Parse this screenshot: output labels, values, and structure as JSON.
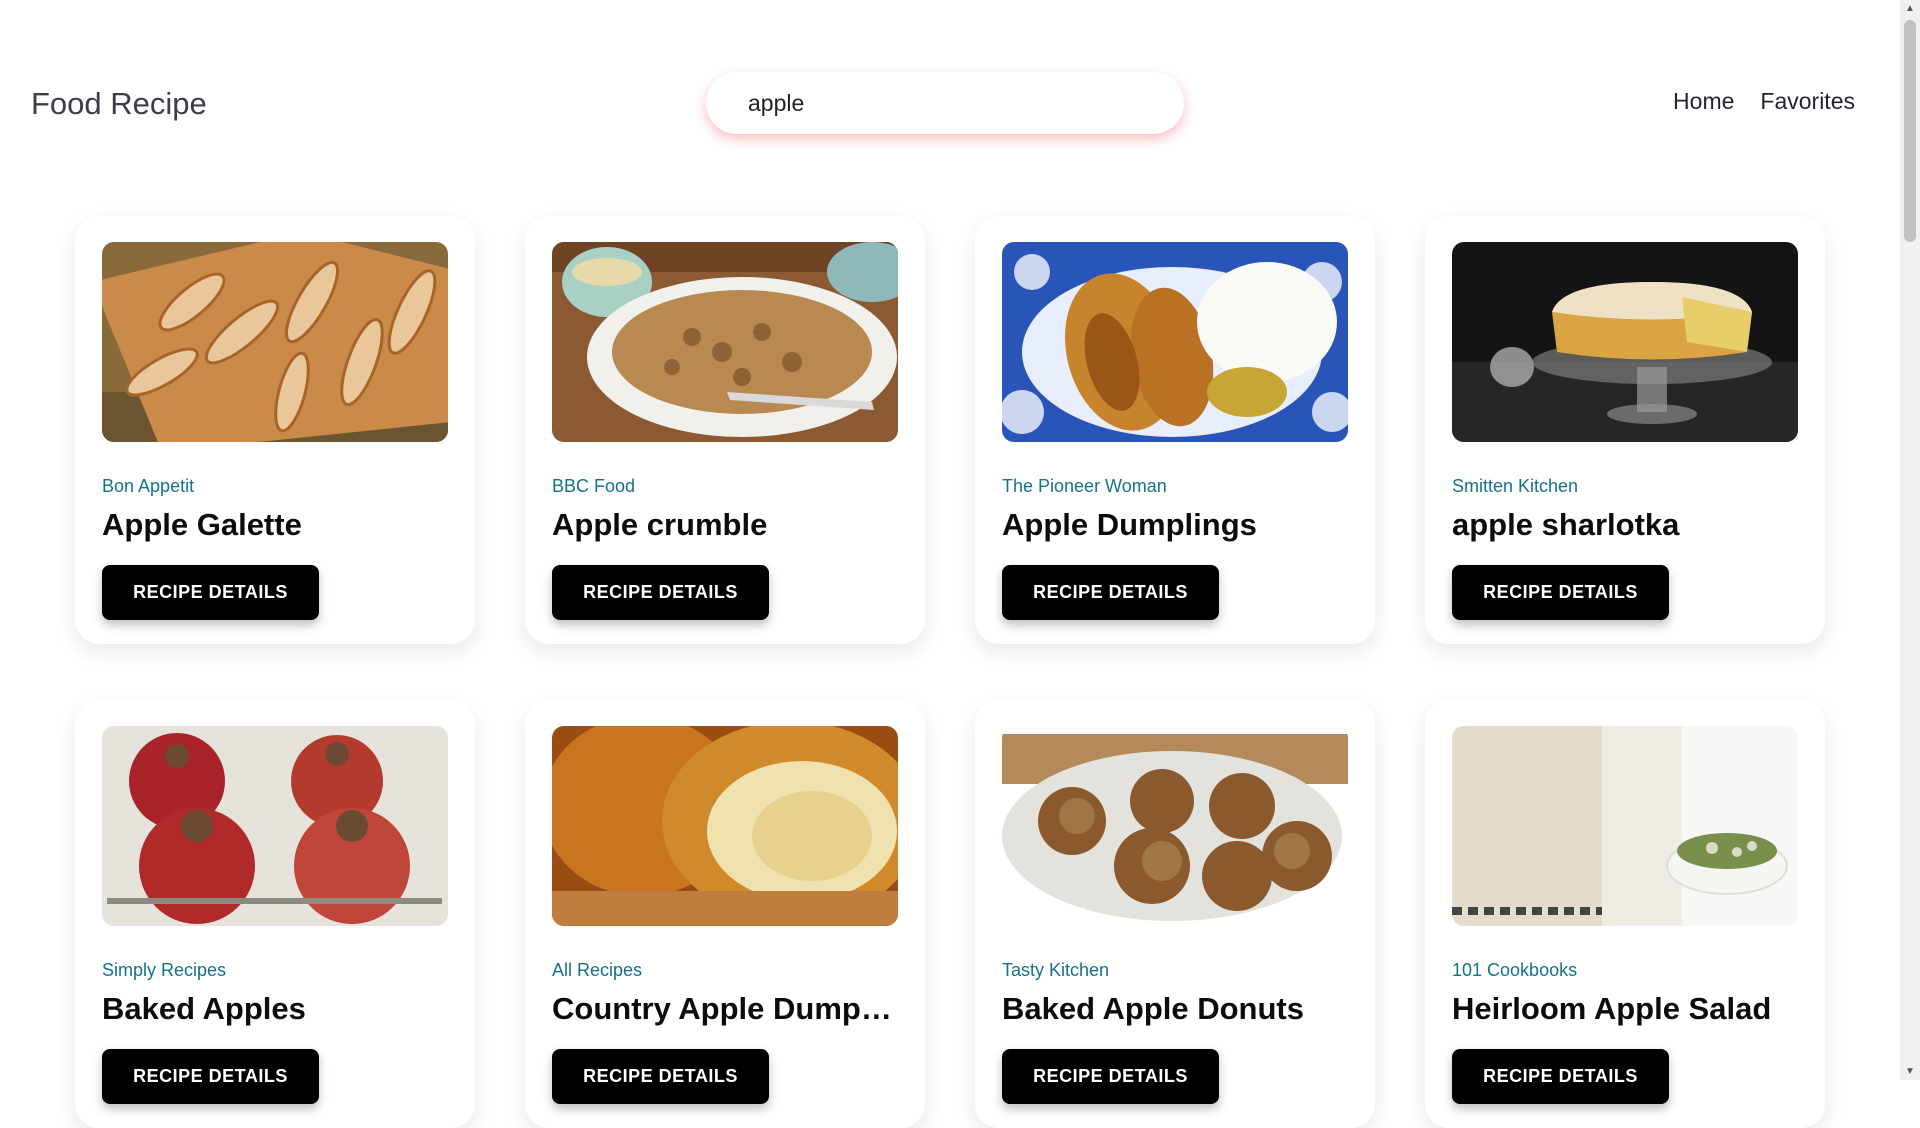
{
  "header": {
    "brand": "Food Recipe",
    "search_value": "apple",
    "nav": [
      "Home",
      "Favorites"
    ]
  },
  "recipes": [
    {
      "publisher": "Bon Appetit",
      "title": "Apple Galette",
      "button": "RECIPE DETAILS"
    },
    {
      "publisher": "BBC Food",
      "title": "Apple crumble",
      "button": "RECIPE DETAILS"
    },
    {
      "publisher": "The Pioneer Woman",
      "title": "Apple Dumplings",
      "button": "RECIPE DETAILS"
    },
    {
      "publisher": "Smitten Kitchen",
      "title": "apple sharlotka",
      "button": "RECIPE DETAILS"
    },
    {
      "publisher": "Simply Recipes",
      "title": "Baked Apples",
      "button": "RECIPE DETAILS"
    },
    {
      "publisher": "All Recipes",
      "title": "Country Apple Dumplings",
      "button": "RECIPE DETAILS"
    },
    {
      "publisher": "Tasty Kitchen",
      "title": "Baked Apple Donuts",
      "button": "RECIPE DETAILS"
    },
    {
      "publisher": "101 Cookbooks",
      "title": "Heirloom Apple Salad",
      "button": "RECIPE DETAILS"
    }
  ],
  "colors": {
    "publisher": "#14728a",
    "button_bg": "#000000",
    "search_glow": "#f47272"
  },
  "icons": {
    "scroll_up": "scroll-up-arrow-icon",
    "scroll_down": "scroll-down-arrow-icon"
  }
}
